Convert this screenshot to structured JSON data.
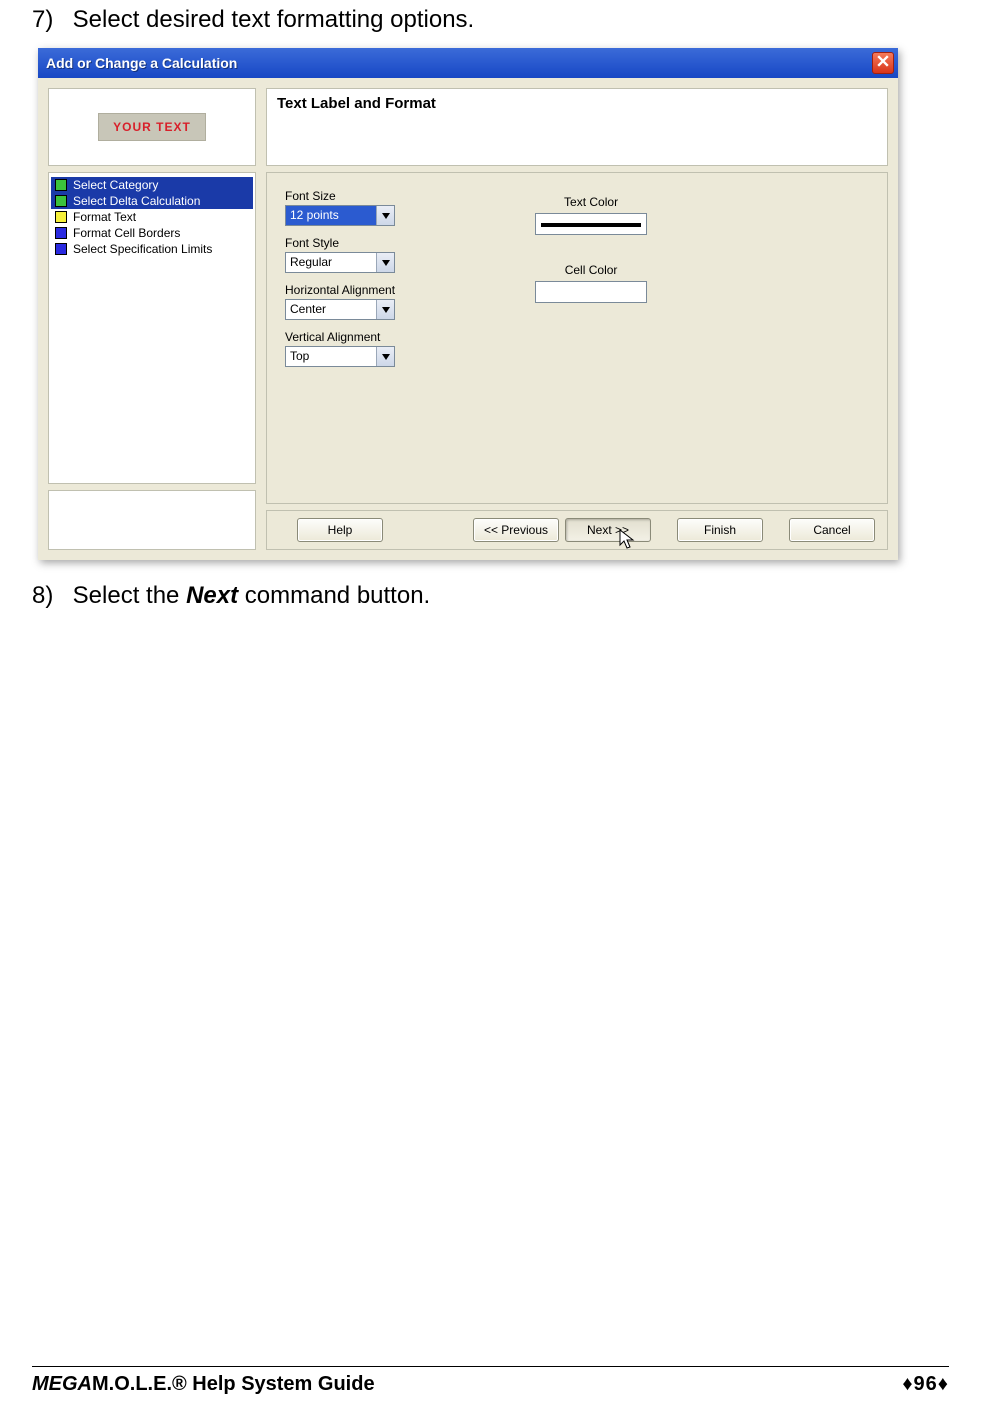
{
  "step7": {
    "num": "7)",
    "text": "Select desired text formatting options."
  },
  "step8": {
    "num": "8)",
    "prefix": "Select the ",
    "em": "Next",
    "suffix": " command button."
  },
  "dialog": {
    "title": "Add or Change a Calculation",
    "preview_text": "YOUR TEXT",
    "steps": [
      {
        "color": "green",
        "label": "Select Category"
      },
      {
        "color": "green",
        "label": "Select Delta Calculation"
      },
      {
        "color": "yellow",
        "label": "Format Text"
      },
      {
        "color": "blue",
        "label": "Format Cell Borders"
      },
      {
        "color": "blue",
        "label": "Select Specification Limits"
      }
    ],
    "heading": "Text Label and Format",
    "fields": {
      "font_size": {
        "label": "Font Size",
        "value": "12 points"
      },
      "font_style": {
        "label": "Font Style",
        "value": "Regular"
      },
      "h_align": {
        "label": "Horizontal Alignment",
        "value": "Center"
      },
      "v_align": {
        "label": "Vertical Alignment",
        "value": "Top"
      },
      "text_color": {
        "label": "Text Color"
      },
      "cell_color": {
        "label": "Cell Color"
      }
    },
    "buttons": {
      "help": "Help",
      "prev": "<< Previous",
      "next": "Next >>",
      "finish": "Finish",
      "cancel": "Cancel"
    }
  },
  "footer": {
    "brand_bold": "MEGA",
    "brand_rest": "M.O.L.E.® Help System Guide",
    "page": "♦96♦"
  }
}
